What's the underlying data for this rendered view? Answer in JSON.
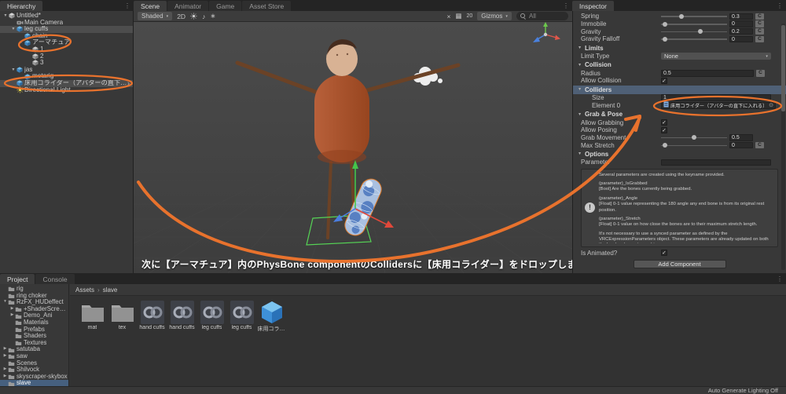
{
  "tabs": {
    "hierarchy": "Hierarchy",
    "scene": "Scene",
    "animator": "Animator",
    "game": "Game",
    "asset_store": "Asset Store",
    "inspector": "Inspector",
    "project": "Project",
    "console": "Console"
  },
  "hierarchy": {
    "items": [
      {
        "label": "Untitled*",
        "depth": 0,
        "arrow": "▼",
        "icon": "scene"
      },
      {
        "label": "Main Camera",
        "depth": 1,
        "icon": "camera"
      },
      {
        "label": "leg cuffs",
        "depth": 1,
        "arrow": "▼",
        "icon": "prefab",
        "selected": true
      },
      {
        "label": "chain",
        "depth": 2,
        "icon": "prefab"
      },
      {
        "label": "アーマチュア",
        "depth": 2,
        "arrow": "▼",
        "icon": "prefab"
      },
      {
        "label": "1",
        "depth": 3,
        "icon": "cube"
      },
      {
        "label": "2",
        "depth": 3,
        "icon": "cube"
      },
      {
        "label": "3",
        "depth": 3,
        "icon": "cube"
      },
      {
        "label": "jas",
        "depth": 1,
        "arrow": "▼",
        "icon": "prefab"
      },
      {
        "label": "metarig",
        "depth": 2,
        "icon": "prefab"
      },
      {
        "label": "床用コライダー（アバターの直下に入れる）",
        "depth": 1,
        "icon": "prefab",
        "selected": true,
        "chevron": true
      },
      {
        "label": "Directional Light",
        "depth": 1,
        "icon": "light"
      }
    ]
  },
  "scene_toolbar": {
    "shaded": "Shaded",
    "mode_2d": "2D",
    "grid_value": "20",
    "gizmos": "Gizmos",
    "search_placeholder": "All"
  },
  "scene": {
    "annotation_text": "次に【アーマチュア】内のPhysBone componentのCollidersに【床用コライダー】をドロップします"
  },
  "inspector": {
    "rows": [
      {
        "type": "slider",
        "label": "Spring",
        "value": "0.3",
        "frac": 0.3,
        "curve": true
      },
      {
        "type": "slider",
        "label": "Immobile",
        "value": "0",
        "frac": 0.02,
        "curve": true
      },
      {
        "type": "slider",
        "label": "Gravity",
        "value": "0.2",
        "frac": 0.6,
        "curve": true
      },
      {
        "type": "slider",
        "label": "Gravity Falloff",
        "value": "0",
        "frac": 0.02,
        "curve": true
      },
      {
        "type": "header",
        "label": "Limits"
      },
      {
        "type": "dropdown",
        "label": "Limit Type",
        "value": "None"
      },
      {
        "type": "header",
        "label": "Collision"
      },
      {
        "type": "field",
        "label": "Radius",
        "value": "0.5",
        "curve": true
      },
      {
        "type": "check",
        "label": "Allow Collision",
        "checked": true
      },
      {
        "type": "header",
        "label": "Colliders",
        "highlight": true
      },
      {
        "type": "field",
        "label": "Size",
        "value": "1",
        "indent": 1
      },
      {
        "type": "object",
        "label": "Element 0",
        "value": "床用コライダー（アバターの直下に入れる）(VRC",
        "indent": 1,
        "annotated": true
      },
      {
        "type": "header",
        "label": "Grab & Pose"
      },
      {
        "type": "check",
        "label": "Allow Grabbing",
        "checked": true
      },
      {
        "type": "check",
        "label": "Allow Posing",
        "checked": true
      },
      {
        "type": "slider",
        "label": "Grab Movement",
        "value": "0.5",
        "frac": 0.5,
        "curve": false
      },
      {
        "type": "slider",
        "label": "Max Stretch",
        "value": "0",
        "frac": 0.02,
        "curve": true
      },
      {
        "type": "header",
        "label": "Options"
      },
      {
        "type": "field",
        "label": "Parameter",
        "value": ""
      },
      {
        "type": "helpbox"
      },
      {
        "type": "check",
        "label": "Is Animated?",
        "checked": true
      }
    ],
    "help_paragraphs": [
      "Several parameters are created using the keyname provided.",
      "(parameter)_IsGrabbed\n[Bool] Are the bones currently being grabbed.",
      "(parameter)_Angle\n[Float] 0-1 value representing the 180 angle any end bone is from its original rest position.",
      "(parameter)_Stretch\n[Float] 0-1 value on how close the bones are to their maximum stretch length.",
      "It's not necessary to use a synced parameter as defined by the VRCExpressionParameters object. These parameters are already updated on both the local and remote machines."
    ],
    "add_component": "Add Component"
  },
  "project": {
    "tree": [
      {
        "label": "rig",
        "depth": 0
      },
      {
        "label": "ring choker",
        "depth": 0
      },
      {
        "label": "RzFX_HUDeffect",
        "depth": 0,
        "arrow": "▼"
      },
      {
        "label": "+ShaderScreens",
        "depth": 1,
        "arrow": "▶"
      },
      {
        "label": "Demo_Ani",
        "depth": 1,
        "arrow": "▶"
      },
      {
        "label": "Materials",
        "depth": 1
      },
      {
        "label": "Prefabs",
        "depth": 1
      },
      {
        "label": "Shaders",
        "depth": 1
      },
      {
        "label": "Textures",
        "depth": 1
      },
      {
        "label": "satutaba",
        "depth": 0,
        "arrow": "▶"
      },
      {
        "label": "saw",
        "depth": 0,
        "arrow": "▶"
      },
      {
        "label": "Scenes",
        "depth": 0
      },
      {
        "label": "Shilvock",
        "depth": 0,
        "arrow": "▶"
      },
      {
        "label": "skyscraper-skybox",
        "depth": 0,
        "arrow": "▶"
      },
      {
        "label": "slave",
        "depth": 0,
        "selected": true
      }
    ],
    "breadcrumb": {
      "root": "Assets",
      "sep": "›",
      "current": "slave"
    },
    "assets": [
      {
        "label": "mat",
        "type": "folder"
      },
      {
        "label": "tex",
        "type": "folder"
      },
      {
        "label": "hand cuffs",
        "type": "prefab"
      },
      {
        "label": "hand cuffs",
        "type": "prefab"
      },
      {
        "label": "leg cuffs",
        "type": "prefab"
      },
      {
        "label": "leg cuffs",
        "type": "prefab"
      },
      {
        "label": "床用コライダー",
        "type": "cube"
      }
    ],
    "status": "Auto Generate Lighting Off"
  },
  "colors": {
    "annotation_orange": "#e8722d",
    "selection_gray": "#4d4d4d",
    "selection_blue": "#46607f"
  }
}
